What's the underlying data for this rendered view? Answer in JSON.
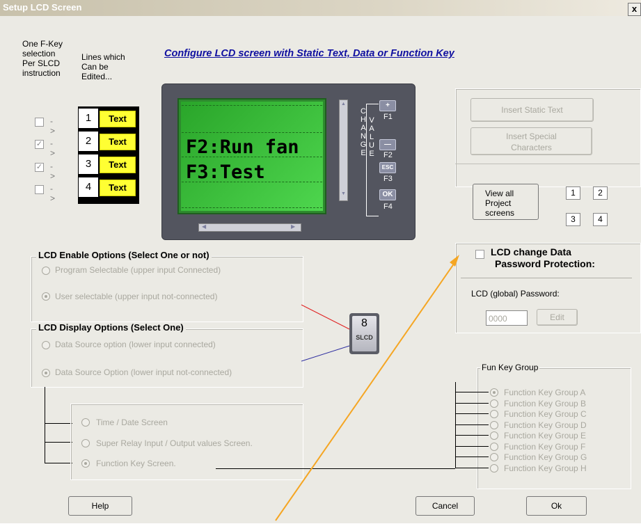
{
  "title": "Setup LCD Screen",
  "close_label": "x",
  "header": {
    "fkey_lines": [
      "One F-Key",
      "selection",
      "Per SLCD",
      "instruction"
    ],
    "edit_lines": [
      "Lines which",
      "Can be",
      "Edited..."
    ],
    "configure_title": "Configure LCD screen with Static Text, Data or Function Key"
  },
  "lines": [
    {
      "num": "1",
      "text": "Text",
      "checked": false
    },
    {
      "num": "2",
      "text": "Text",
      "checked": true
    },
    {
      "num": "3",
      "text": "Text",
      "checked": true
    },
    {
      "num": "4",
      "text": "Text",
      "checked": false
    }
  ],
  "arrow_symbol": "->",
  "lcd": {
    "line2": "F2:Run fan",
    "line3": "F3:Test",
    "change_label": "CHANGE",
    "value_label": "VALUE",
    "keys": [
      {
        "btn": "+",
        "label": "F1"
      },
      {
        "btn": "—",
        "label": "F2"
      },
      {
        "btn": "ESC",
        "label": "F3"
      },
      {
        "btn": "OK",
        "label": "F4"
      }
    ]
  },
  "right": {
    "insert_static": "Insert Static Text",
    "insert_special_1": "Insert Special",
    "insert_special_2": "Characters",
    "view_all_1": "View all",
    "view_all_2": "Project",
    "view_all_3": "screens",
    "screens": [
      "1",
      "2",
      "3",
      "4"
    ],
    "password_title_1": "LCD change Data",
    "password_title_2": "Password Protection:",
    "global_password_label": "LCD (global) Password:",
    "password_value": "0000",
    "edit_label": "Edit"
  },
  "enable_options": {
    "title": "LCD Enable Options (Select One or not)",
    "opt1": "Program Selectable (upper input Connected)",
    "opt2": "User selectable (upper input not-connected)"
  },
  "display_options": {
    "title": "LCD Display Options (Select One)",
    "opt1": "Data Source option (lower input connected)",
    "opt2": "Data Source Option (lower input not-connected)"
  },
  "slcd_block": {
    "num": "8",
    "label": "SLCD"
  },
  "screen_options": {
    "opt1": "Time / Date Screen",
    "opt2": "Super Relay Input / Output values Screen.",
    "opt3": "Function Key Screen."
  },
  "fun_key_group": {
    "title": "Fun Key Group",
    "items": [
      "Function Key Group A",
      "Function Key Group B",
      "Function Key Group C",
      "Function Key Group D",
      "Function Key Group E",
      "Function Key Group F",
      "Function Key Group G",
      "Function Key Group H"
    ]
  },
  "buttons": {
    "help": "Help",
    "cancel": "Cancel",
    "ok": "Ok"
  },
  "colors": {
    "lcd_screen": "#3ec13e",
    "text_yellow": "#ffff33",
    "annotation_arrow": "#f5a623"
  }
}
